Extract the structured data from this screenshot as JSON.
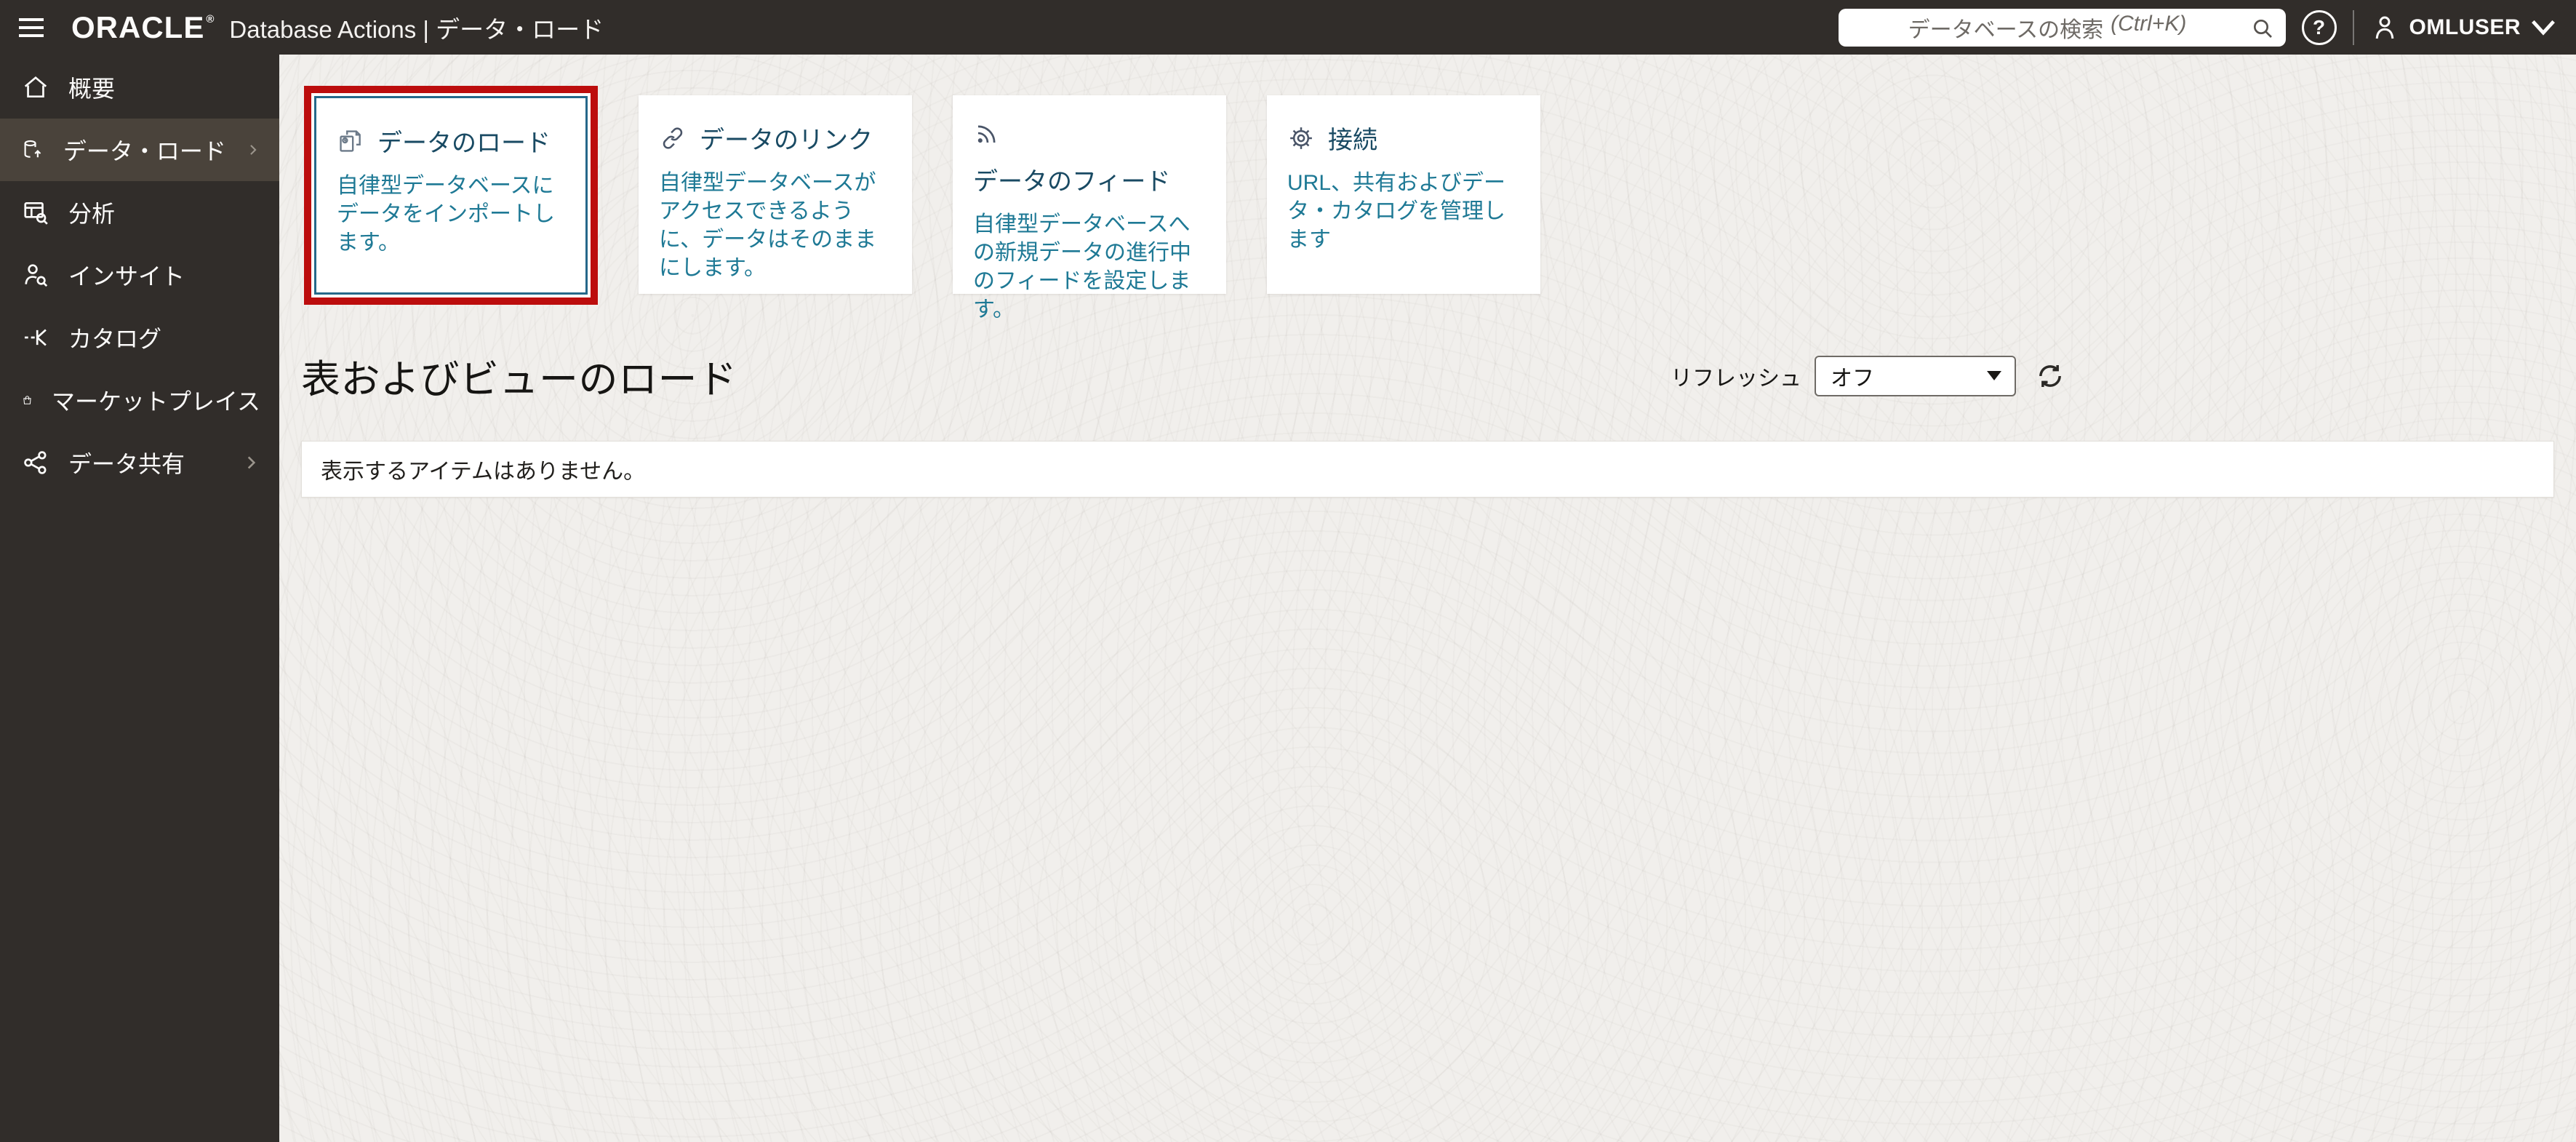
{
  "header": {
    "brand": "ORACLE",
    "reg_mark": "®",
    "app_title": "Database Actions | データ・ロード",
    "search_placeholder": "データベースの検索",
    "search_shortcut": "(Ctrl+K)",
    "help_glyph": "?",
    "username": "OMLUSER"
  },
  "sidebar": {
    "items": [
      {
        "label": "概要",
        "icon": "home-icon",
        "selected": false,
        "has_submenu": false
      },
      {
        "label": "データ・ロード",
        "icon": "data-load-icon",
        "selected": true,
        "has_submenu": true
      },
      {
        "label": "分析",
        "icon": "analysis-icon",
        "selected": false,
        "has_submenu": false
      },
      {
        "label": "インサイト",
        "icon": "insights-icon",
        "selected": false,
        "has_submenu": false
      },
      {
        "label": "カタログ",
        "icon": "catalog-icon",
        "selected": false,
        "has_submenu": false
      },
      {
        "label": "マーケットプレイス",
        "icon": "marketplace-icon",
        "selected": false,
        "has_submenu": false
      },
      {
        "label": "データ共有",
        "icon": "data-share-icon",
        "selected": false,
        "has_submenu": true
      }
    ]
  },
  "cards": [
    {
      "title": "データのロード",
      "description": "自律型データベースにデータをインポートします。",
      "icon": "load-data-icon",
      "highlighted": true
    },
    {
      "title": "データのリンク",
      "description": "自律型データベースがアクセスできるように、データはそのままにします。",
      "icon": "link-data-icon",
      "highlighted": false
    },
    {
      "title": "データのフィード",
      "description": "自律型データベースへの新規データの進行中のフィードを設定します。",
      "icon": "feed-data-icon",
      "highlighted": false
    },
    {
      "title": "接続",
      "description": "URL、共有およびデータ・カタログを管理します",
      "icon": "connections-icon",
      "highlighted": false
    }
  ],
  "section": {
    "title": "表およびビューのロード",
    "refresh_label": "リフレッシュ",
    "refresh_value": "オフ",
    "empty_message": "表示するアイテムはありません。"
  },
  "colors": {
    "header_bg": "#312d2a",
    "sidebar_selected_bg": "#4a433b",
    "highlight_border": "#bc0d0d",
    "selected_card_border": "#25688a",
    "card_title": "#194a63",
    "card_description": "#1e7995",
    "main_bg": "#f1efec"
  }
}
